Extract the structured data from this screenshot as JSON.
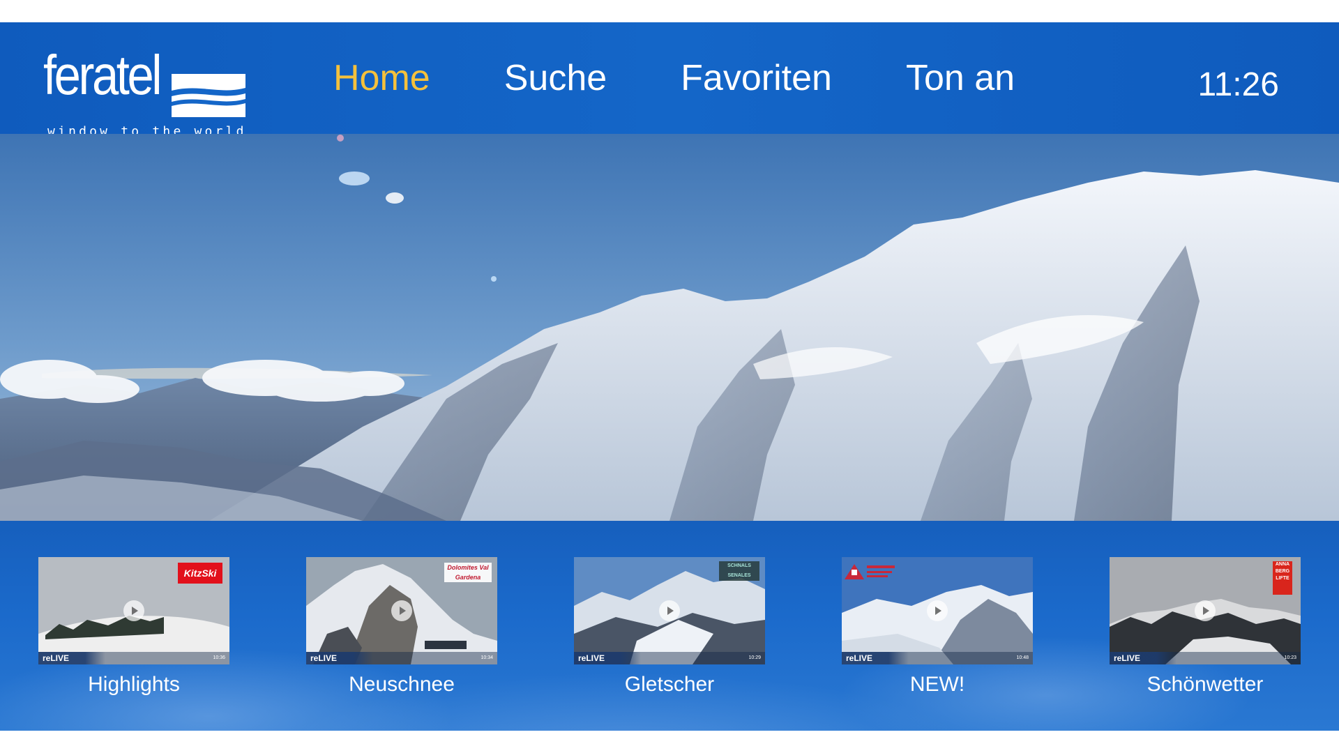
{
  "brand": {
    "name": "feratel",
    "tagline": "window to the world"
  },
  "nav": {
    "items": [
      {
        "label": "Home",
        "active": true
      },
      {
        "label": "Suche",
        "active": false
      },
      {
        "label": "Favoriten",
        "active": false
      },
      {
        "label": "Ton an",
        "active": false
      }
    ]
  },
  "clock": "11:26",
  "hero": {
    "description_icon": "mountain-panorama-image"
  },
  "rail": {
    "cards": [
      {
        "label": "Highlights",
        "relive": "reLIVE",
        "time": "10:36",
        "badge": "KitzSki"
      },
      {
        "label": "Neuschnee",
        "relive": "reLIVE",
        "time": "10:34",
        "badge": "Dolomites Val Gardena"
      },
      {
        "label": "Gletscher",
        "relive": "reLIVE",
        "time": "10:29",
        "badge": "SCHNALS SENALES"
      },
      {
        "label": "NEW!",
        "relive": "reLIVE",
        "time": "10:48",
        "badge": ""
      },
      {
        "label": "Schönwetter",
        "relive": "reLIVE",
        "time": "10:23",
        "badge": "ANNA BERG LIFTE"
      }
    ]
  },
  "colors": {
    "brand_blue": "#1466c8",
    "active_nav": "#f5c13c",
    "text": "#ffffff"
  }
}
